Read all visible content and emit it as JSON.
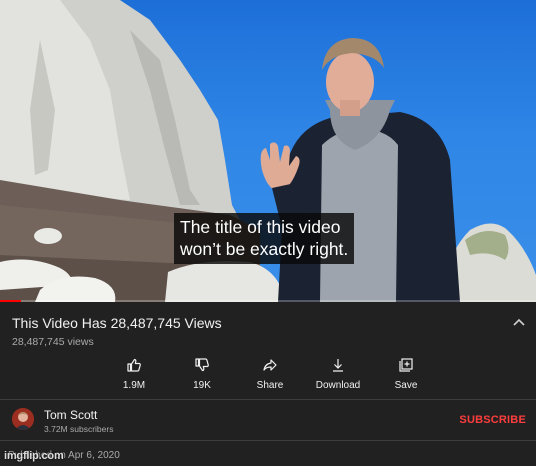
{
  "video": {
    "caption_line1": "The title of this video",
    "caption_line2": "won’t be exactly right.",
    "progress_fraction": 0.04
  },
  "info": {
    "title": "This Video Has 28,487,745 Views",
    "views": "28,487,745 views"
  },
  "actions": [
    {
      "icon": "thumbs-up-icon",
      "label": "1.9M"
    },
    {
      "icon": "thumbs-down-icon",
      "label": "19K"
    },
    {
      "icon": "share-icon",
      "label": "Share"
    },
    {
      "icon": "download-icon",
      "label": "Download"
    },
    {
      "icon": "save-icon",
      "label": "Save"
    }
  ],
  "channel": {
    "name": "Tom Scott",
    "subscribers": "3.72M subscribers",
    "subscribe_label": "SUBSCRIBE"
  },
  "published": "Published on Apr 6, 2020",
  "watermark": "imgflip.com",
  "colors": {
    "background": "#212121",
    "subscribe": "#ff3d3d",
    "progress": "#ff0000",
    "secondary_text": "#aaaaaa"
  }
}
